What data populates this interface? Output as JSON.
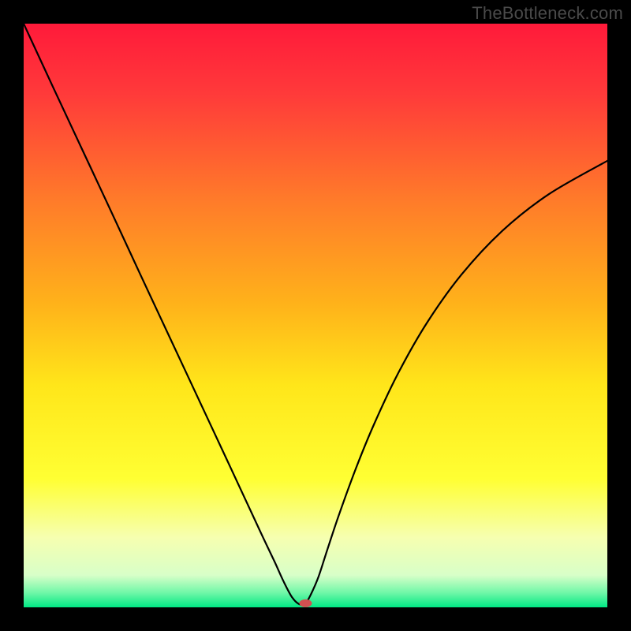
{
  "watermark": "TheBottleneck.com",
  "chart_data": {
    "type": "line",
    "title": "",
    "xlabel": "",
    "ylabel": "",
    "xlim": [
      0,
      100
    ],
    "ylim": [
      0,
      100
    ],
    "grid": false,
    "legend": false,
    "background_gradient": {
      "stops": [
        {
          "offset": 0.0,
          "color": "#ff1a3a"
        },
        {
          "offset": 0.12,
          "color": "#ff3a3a"
        },
        {
          "offset": 0.3,
          "color": "#ff7a2a"
        },
        {
          "offset": 0.48,
          "color": "#ffb21a"
        },
        {
          "offset": 0.62,
          "color": "#ffe61a"
        },
        {
          "offset": 0.78,
          "color": "#ffff33"
        },
        {
          "offset": 0.88,
          "color": "#f6ffb0"
        },
        {
          "offset": 0.945,
          "color": "#d8ffc8"
        },
        {
          "offset": 0.975,
          "color": "#70f7a8"
        },
        {
          "offset": 1.0,
          "color": "#00e884"
        }
      ]
    },
    "curve": {
      "description": "V-shaped bottleneck curve that drops from top-left to a minimum near the bottom, then rises toward the right edge",
      "x": [
        0,
        5,
        10,
        15,
        20,
        25,
        30,
        35,
        39,
        41,
        43,
        44.5,
        46,
        47.3,
        48.3,
        49.2,
        50.5,
        52,
        54,
        57,
        60,
        64,
        69,
        75,
        82,
        90,
        100
      ],
      "y": [
        100,
        89.2,
        78.5,
        67.8,
        57.0,
        46.3,
        35.6,
        24.9,
        16.3,
        12.0,
        7.8,
        4.5,
        1.7,
        0.5,
        0.7,
        2.2,
        5.2,
        9.8,
        15.8,
        24.0,
        31.3,
        39.8,
        48.6,
        57.0,
        64.5,
        70.8,
        76.5
      ]
    },
    "marker": {
      "description": "Small rounded red dot marking the current configuration near curve minimum",
      "x": 48.3,
      "y": 0.7,
      "color": "#d05050",
      "rx": 8,
      "ry": 5
    }
  }
}
